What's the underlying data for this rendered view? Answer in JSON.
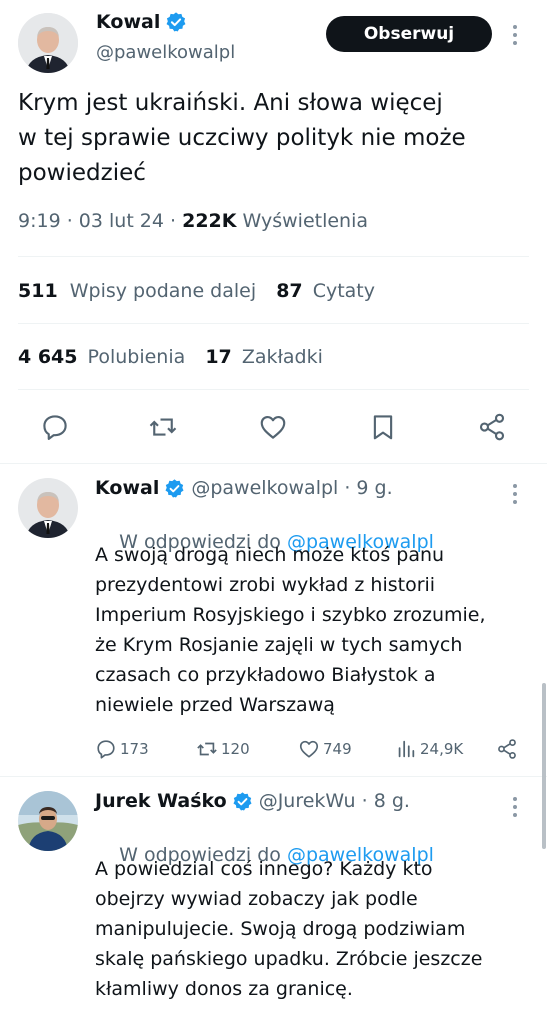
{
  "main_tweet": {
    "author_name": "Kowal",
    "author_handle": "@pawelkowalpl",
    "follow_label": "Obserwuj",
    "text_line1": "Krym jest ukraiński. Ani słowa więcej",
    "text_line2": "w tej sprawie uczciwy polityk nie może",
    "text_line3": "powiedzieć",
    "time_date": "9:19 · 03 lut 24 · ",
    "views_count": "222K",
    "views_label": " Wyświetlenia",
    "retweets_count": "511",
    "retweets_label": "Wpisy podane dalej",
    "quotes_count": "87",
    "quotes_label": "Cytaty",
    "likes_count": "4 645",
    "likes_label": "Polubienia",
    "bookmarks_count": "17",
    "bookmarks_label": "Zakładki"
  },
  "replies": [
    {
      "author_name": "Kowal",
      "author_handle": "@pawelkowalpl",
      "time": " · 9 g.",
      "reply_to_prefix": "W odpowiedzi do ",
      "reply_to_handle": "@pawelkowalpl",
      "lines": [
        "A swoją drogą niech może ktoś panu",
        "prezydentowi zrobi wykład z historii",
        "Imperium Rosyjskiego i szybko zrozumie,",
        "że Krym Rosjanie zajęli w tych samych",
        "czasach co przykładowo Białystok a",
        "niewiele przed Warszawą"
      ],
      "replies_count": "173",
      "retweets_count": "120",
      "likes_count": "749",
      "views_count": "24,9K"
    },
    {
      "author_name": "Jurek Waśko",
      "author_handle": "@JurekWu",
      "time": " · 8 g.",
      "reply_to_prefix": "W odpowiedzi do ",
      "reply_to_handle": "@pawelkowalpl",
      "lines": [
        "A powiedzial coś innego? Każdy kto",
        "obejrzy wywiad zobaczy jak podle",
        "manipulujecie. Swoją drogą podziwiam",
        "skalę pańskiego upadku. Zróbcie jeszcze",
        "kłamliwy donos za granicę."
      ]
    }
  ],
  "colors": {
    "verified": "#1d9bf0",
    "link": "#1d9bf0",
    "text": "#0f1419",
    "muted": "#536471",
    "divider": "#eff3f4"
  },
  "icons": {
    "verified": "verified-badge-icon",
    "reply": "reply-icon",
    "retweet": "retweet-icon",
    "like": "heart-icon",
    "bookmark": "bookmark-icon",
    "share": "share-icon",
    "views": "views-chart-icon",
    "more": "more-dots-icon"
  }
}
